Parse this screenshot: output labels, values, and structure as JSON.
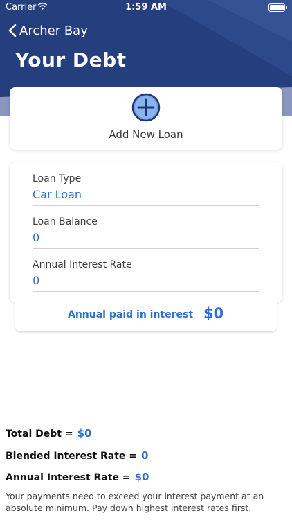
{
  "status_bar": {
    "carrier": "Carrier",
    "time": "1:59 AM"
  },
  "nav": {
    "back_label": "Archer Bay",
    "title": "Your Debt"
  },
  "add_loan": {
    "label": "Add New Loan"
  },
  "loan": {
    "type_label": "Loan Type",
    "type_value": "Car Loan",
    "balance_label": "Loan Balance",
    "balance_value": "0",
    "rate_label": "Annual Interest Rate",
    "rate_value": "0"
  },
  "interest": {
    "label": "Annual paid in interest",
    "value": "$0"
  },
  "summary": {
    "total_debt_label": "Total Debt =",
    "total_debt_value": "$0",
    "blended_rate_label": "Blended Interest Rate =",
    "blended_rate_value": "0",
    "annual_rate_label": "Annual Interest Rate =",
    "annual_rate_value": "$0",
    "note": "Your payments need to exceed your interest payment at an absolute minimum. Pay down highest interest rates first."
  },
  "colors": {
    "header_dark": "#253f7e",
    "header_light": "#8a96bf",
    "accent_blue": "#2f6fcf"
  },
  "icons": {
    "back": "chevron-left-icon",
    "add": "plus-circle-icon",
    "wifi": "wifi-icon",
    "battery": "battery-icon"
  }
}
